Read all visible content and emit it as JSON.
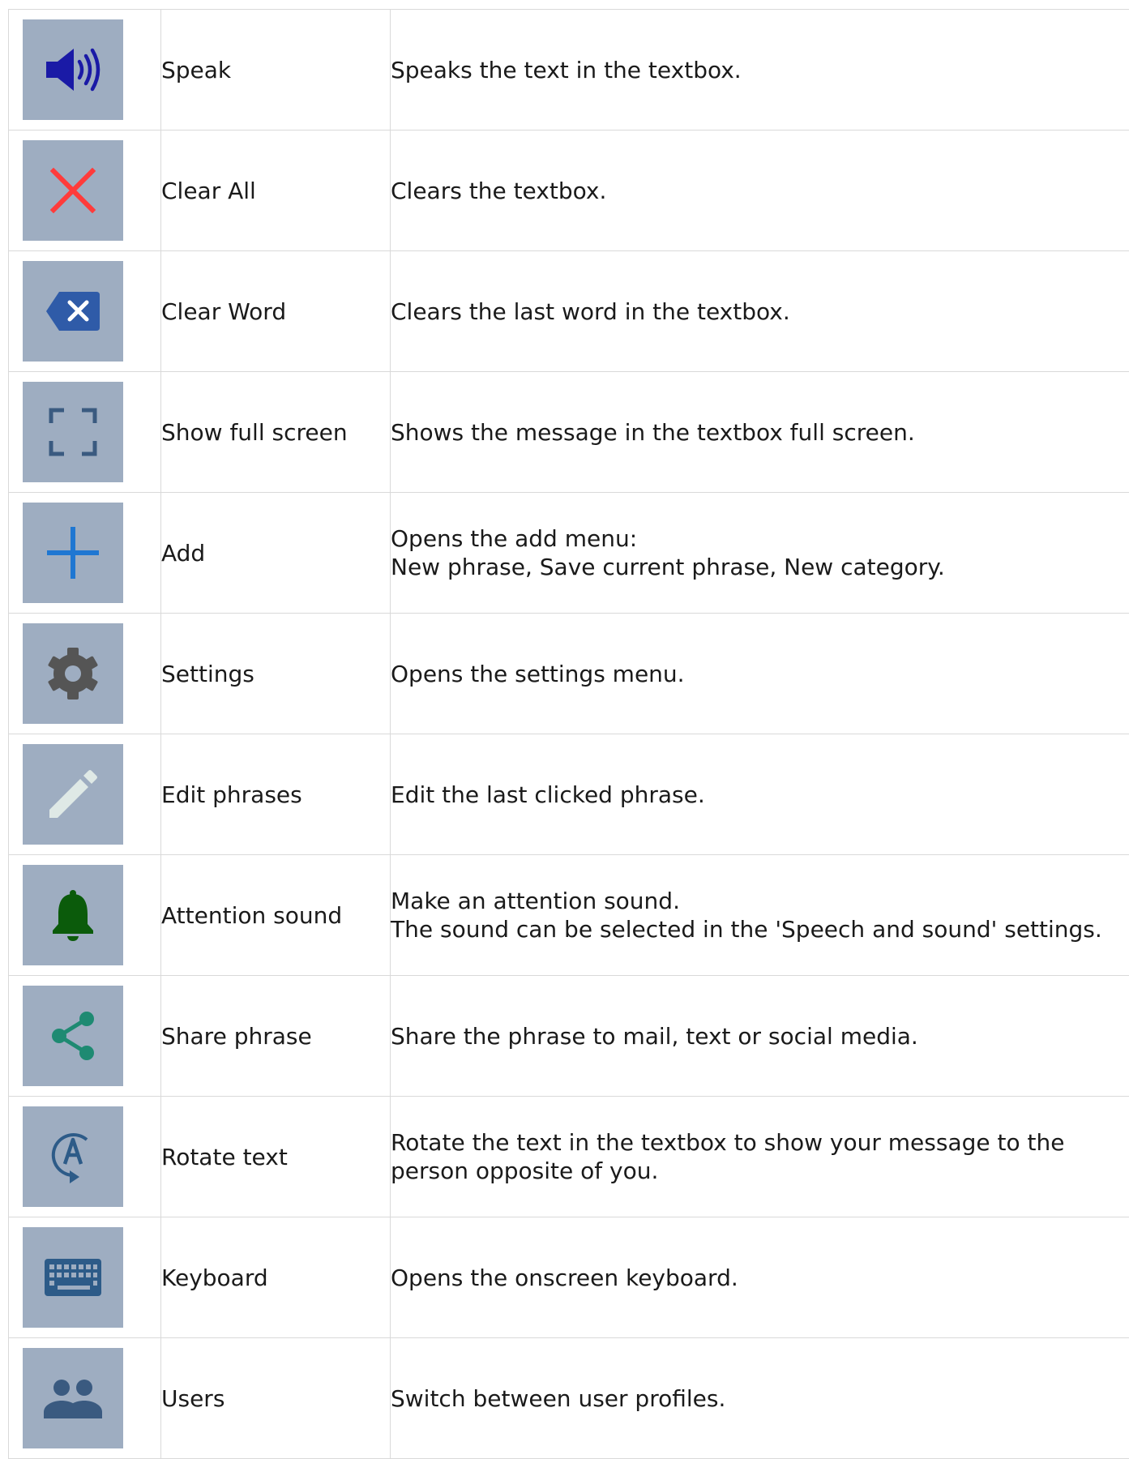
{
  "rows": [
    {
      "icon": "speaker-icon",
      "name": "Speak",
      "description": "Speaks the text in the textbox."
    },
    {
      "icon": "close-x-icon",
      "name": "Clear All",
      "description": "Clears the textbox."
    },
    {
      "icon": "backspace-icon",
      "name": "Clear Word",
      "description": "Clears the last word in the textbox."
    },
    {
      "icon": "fullscreen-icon",
      "name": "Show full screen",
      "description": "Shows the message in the textbox full screen."
    },
    {
      "icon": "plus-icon",
      "name": "Add",
      "description": "Opens the add menu:\nNew phrase, Save current phrase, New category."
    },
    {
      "icon": "gear-icon",
      "name": "Settings",
      "description": "Opens the settings menu."
    },
    {
      "icon": "pencil-icon",
      "name": "Edit phrases",
      "description": "Edit the last clicked phrase."
    },
    {
      "icon": "bell-icon",
      "name": "Attention sound",
      "description": "Make an attention sound.\nThe sound can be selected in the 'Speech and sound' settings."
    },
    {
      "icon": "share-icon",
      "name": "Share phrase",
      "description": "Share the phrase to mail, text or social media."
    },
    {
      "icon": "rotate-text-icon",
      "name": "Rotate text",
      "description": "Rotate the text in the textbox to show your message to the\nperson opposite of you."
    },
    {
      "icon": "keyboard-icon",
      "name": "Keyboard",
      "description": "Opens the onscreen keyboard."
    },
    {
      "icon": "users-icon",
      "name": "Users",
      "description": "Switch between user profiles."
    }
  ],
  "colors": {
    "icon_background": "#9eadc1",
    "speaker": "#1a1aa6",
    "clear_all": "#ff3b3b",
    "backspace": "#2f5ba8",
    "fullscreen": "#3a5a80",
    "plus": "#1f77d2",
    "gear": "#555555",
    "pencil": "#dfe9e6",
    "bell": "#0b5b0b",
    "share": "#1e8a72",
    "rotate": "#2d5b88",
    "keyboard": "#2d5b88",
    "users": "#3a5a80"
  }
}
